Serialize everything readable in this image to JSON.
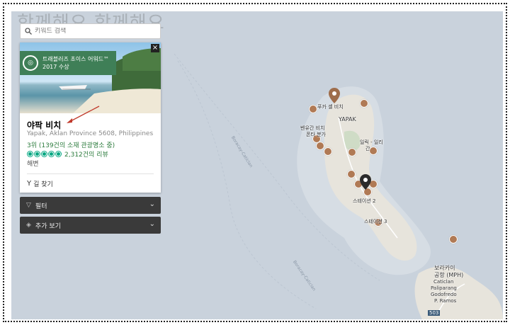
{
  "watermark": "함께해요 함께해요",
  "search": {
    "placeholder": "키워드 검색"
  },
  "card": {
    "close": "×",
    "award_line1": "트래블러즈 초이스 어워드™",
    "award_line2": "2017 수상",
    "name": "야팍 비치",
    "address": "Yapak, Aklan Province 5608, Philippines",
    "rank": "3위 (139건의 소재 관광명소 중)",
    "rating_bubbles": 5,
    "reviews": "2,312건의 리뷰",
    "category": "해변",
    "directions": "길 찾기"
  },
  "panels": {
    "filter": "필터",
    "more": "추가 보기"
  },
  "map": {
    "labels": {
      "puka": "푸카 셸 비치",
      "yapak": "YAPAK",
      "beach1": "벤유간 비치",
      "beach2": "폰타 분가",
      "ilig": "일릭 - 일리",
      "ilig2": "간",
      "station2": "스테이션 2",
      "station3": "스테이션 3",
      "airport1": "보라카이",
      "airport2": "공항 (MPH)",
      "airport3": "Caticlan",
      "airport4": "Paliparang",
      "airport5": "Godofredo",
      "airport6": "P. Ramos",
      "road_num": "503",
      "road1": "Boracay-Caticlan",
      "road2": "Boracay-Caticlan"
    }
  },
  "colors": {
    "water": "#c9d2dc",
    "land": "#e7e4dc",
    "marker": "#b07a55",
    "award": "#3f7f57"
  }
}
